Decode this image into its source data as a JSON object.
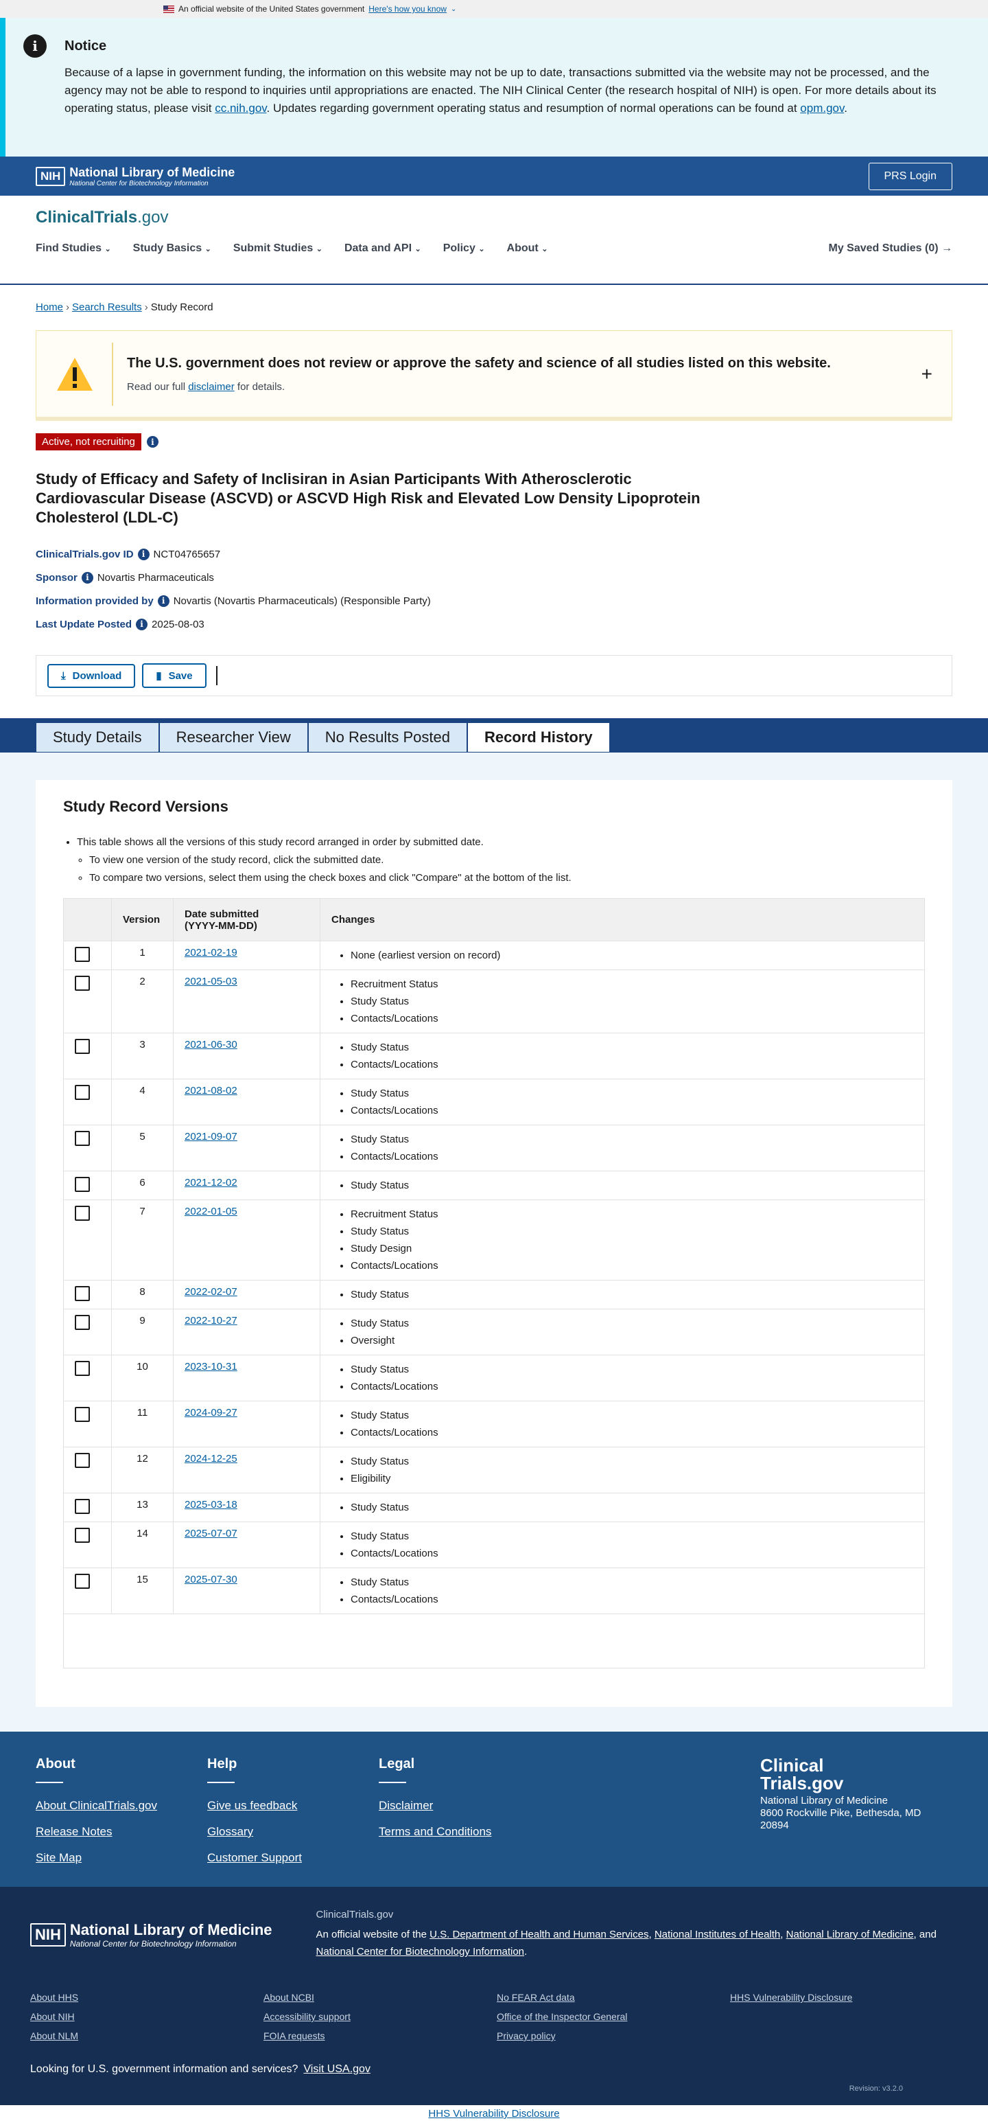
{
  "gov_banner": {
    "text": "An official website of the United States government",
    "link": "Here's how you know"
  },
  "notice": {
    "title": "Notice",
    "body_1": "Because of a lapse in government funding, the information on this website may not be up to date, transactions submitted via the website may not be processed, and the agency may not be able to respond to inquiries until appropriations are enacted. The NIH Clinical Center (the research hospital of NIH) is open. For more details about its operating status, please visit ",
    "link_1": "cc.nih.gov",
    "body_2": ". Updates regarding government operating status and resumption of normal operations can be found at ",
    "link_2": "opm.gov",
    "body_3": "."
  },
  "nlm_bar": {
    "nih": "NIH",
    "name": "National Library of Medicine",
    "sub": "National Center for Biotechnology Information",
    "prs_button": "PRS Login"
  },
  "header": {
    "logo_main": "ClinicalTrials",
    "logo_suffix": ".gov",
    "nav": [
      "Find Studies",
      "Study Basics",
      "Submit Studies",
      "Data and API",
      "Policy",
      "About"
    ],
    "saved": "My Saved Studies (0)"
  },
  "breadcrumb": {
    "home": "Home",
    "search": "Search Results",
    "current": "Study Record"
  },
  "disclaimer": {
    "title": "The U.S. government does not review or approve the safety and science of all studies listed on this website.",
    "pre": "Read our full ",
    "link": "disclaimer",
    "post": " for details."
  },
  "study": {
    "status": "Active, not recruiting",
    "title": "Study of Efficacy and Safety of Inclisiran in Asian Participants With Atherosclerotic Cardiovascular Disease (ASCVD) or ASCVD High Risk and Elevated Low Density Lipoprotein Cholesterol (LDL-C)",
    "id_label": "ClinicalTrials.gov ID",
    "id": "NCT04765657",
    "sponsor_label": "Sponsor",
    "sponsor": "Novartis Pharmaceuticals",
    "provided_label": "Information provided by",
    "provided": "Novartis (Novartis Pharmaceuticals) (Responsible Party)",
    "updated_label": "Last Update Posted",
    "updated": "2025-08-03"
  },
  "actions": {
    "download": "Download",
    "save": "Save"
  },
  "tabs": [
    "Study Details",
    "Researcher View",
    "No Results Posted",
    "Record History"
  ],
  "history": {
    "title": "Study Record Versions",
    "intro": "This table shows all the versions of this study record arranged in order by submitted date.",
    "intro_sub_1": "To view one version of the study record, click the submitted date.",
    "intro_sub_2": "To compare two versions, select them using the check boxes and click \"Compare\" at the bottom of the list.",
    "col_version": "Version",
    "col_date_1": "Date submitted",
    "col_date_2": "(YYYY-MM-DD)",
    "col_changes": "Changes",
    "rows": [
      {
        "version": "1",
        "date": "2021-02-19",
        "changes": [
          "None (earliest version on record)"
        ]
      },
      {
        "version": "2",
        "date": "2021-05-03",
        "changes": [
          "Recruitment Status",
          "Study Status",
          "Contacts/Locations"
        ]
      },
      {
        "version": "3",
        "date": "2021-06-30",
        "changes": [
          "Study Status",
          "Contacts/Locations"
        ]
      },
      {
        "version": "4",
        "date": "2021-08-02",
        "changes": [
          "Study Status",
          "Contacts/Locations"
        ]
      },
      {
        "version": "5",
        "date": "2021-09-07",
        "changes": [
          "Study Status",
          "Contacts/Locations"
        ]
      },
      {
        "version": "6",
        "date": "2021-12-02",
        "changes": [
          "Study Status"
        ]
      },
      {
        "version": "7",
        "date": "2022-01-05",
        "changes": [
          "Recruitment Status",
          "Study Status",
          "Study Design",
          "Contacts/Locations"
        ]
      },
      {
        "version": "8",
        "date": "2022-02-07",
        "changes": [
          "Study Status"
        ]
      },
      {
        "version": "9",
        "date": "2022-10-27",
        "changes": [
          "Study Status",
          "Oversight"
        ]
      },
      {
        "version": "10",
        "date": "2023-10-31",
        "changes": [
          "Study Status",
          "Contacts/Locations"
        ]
      },
      {
        "version": "11",
        "date": "2024-09-27",
        "changes": [
          "Study Status",
          "Contacts/Locations"
        ]
      },
      {
        "version": "12",
        "date": "2024-12-25",
        "changes": [
          "Study Status",
          "Eligibility"
        ]
      },
      {
        "version": "13",
        "date": "2025-03-18",
        "changes": [
          "Study Status"
        ]
      },
      {
        "version": "14",
        "date": "2025-07-07",
        "changes": [
          "Study Status",
          "Contacts/Locations"
        ]
      },
      {
        "version": "15",
        "date": "2025-07-30",
        "changes": [
          "Study Status",
          "Contacts/Locations"
        ]
      }
    ]
  },
  "footer": {
    "about_title": "About",
    "about_links": [
      "About ClinicalTrials.gov",
      "Release Notes",
      "Site Map"
    ],
    "help_title": "Help",
    "help_links": [
      "Give us feedback",
      "Glossary",
      "Customer Support"
    ],
    "legal_title": "Legal",
    "legal_links": [
      "Disclaimer",
      "Terms and Conditions"
    ],
    "logo_1": "Clinical",
    "logo_2": "Trials.gov",
    "address_1": "National Library of Medicine",
    "address_2": "8600 Rockville Pike, Bethesda, MD 20894"
  },
  "footer2": {
    "site": "ClinicalTrials.gov",
    "pre": "An official website of the ",
    "l1": "U.S. Department of Health and Human Services",
    "l2": "National Institutes of Health",
    "l3": "National Library of Medicine",
    "l4": "National Center for Biotechnology Information",
    "links": [
      "About HHS",
      "About NCBI",
      "No FEAR Act data",
      "HHS Vulnerability Disclosure",
      "About NIH",
      "Accessibility support",
      "Office of the Inspector General",
      "",
      "About NLM",
      "FOIA requests",
      "Privacy policy",
      ""
    ],
    "usa_text": "Looking for U.S. government information and services?",
    "usa_link": "Visit USA.gov",
    "revision": "Revision: v3.2.0"
  },
  "bottom_link": "HHS Vulnerability Disclosure"
}
